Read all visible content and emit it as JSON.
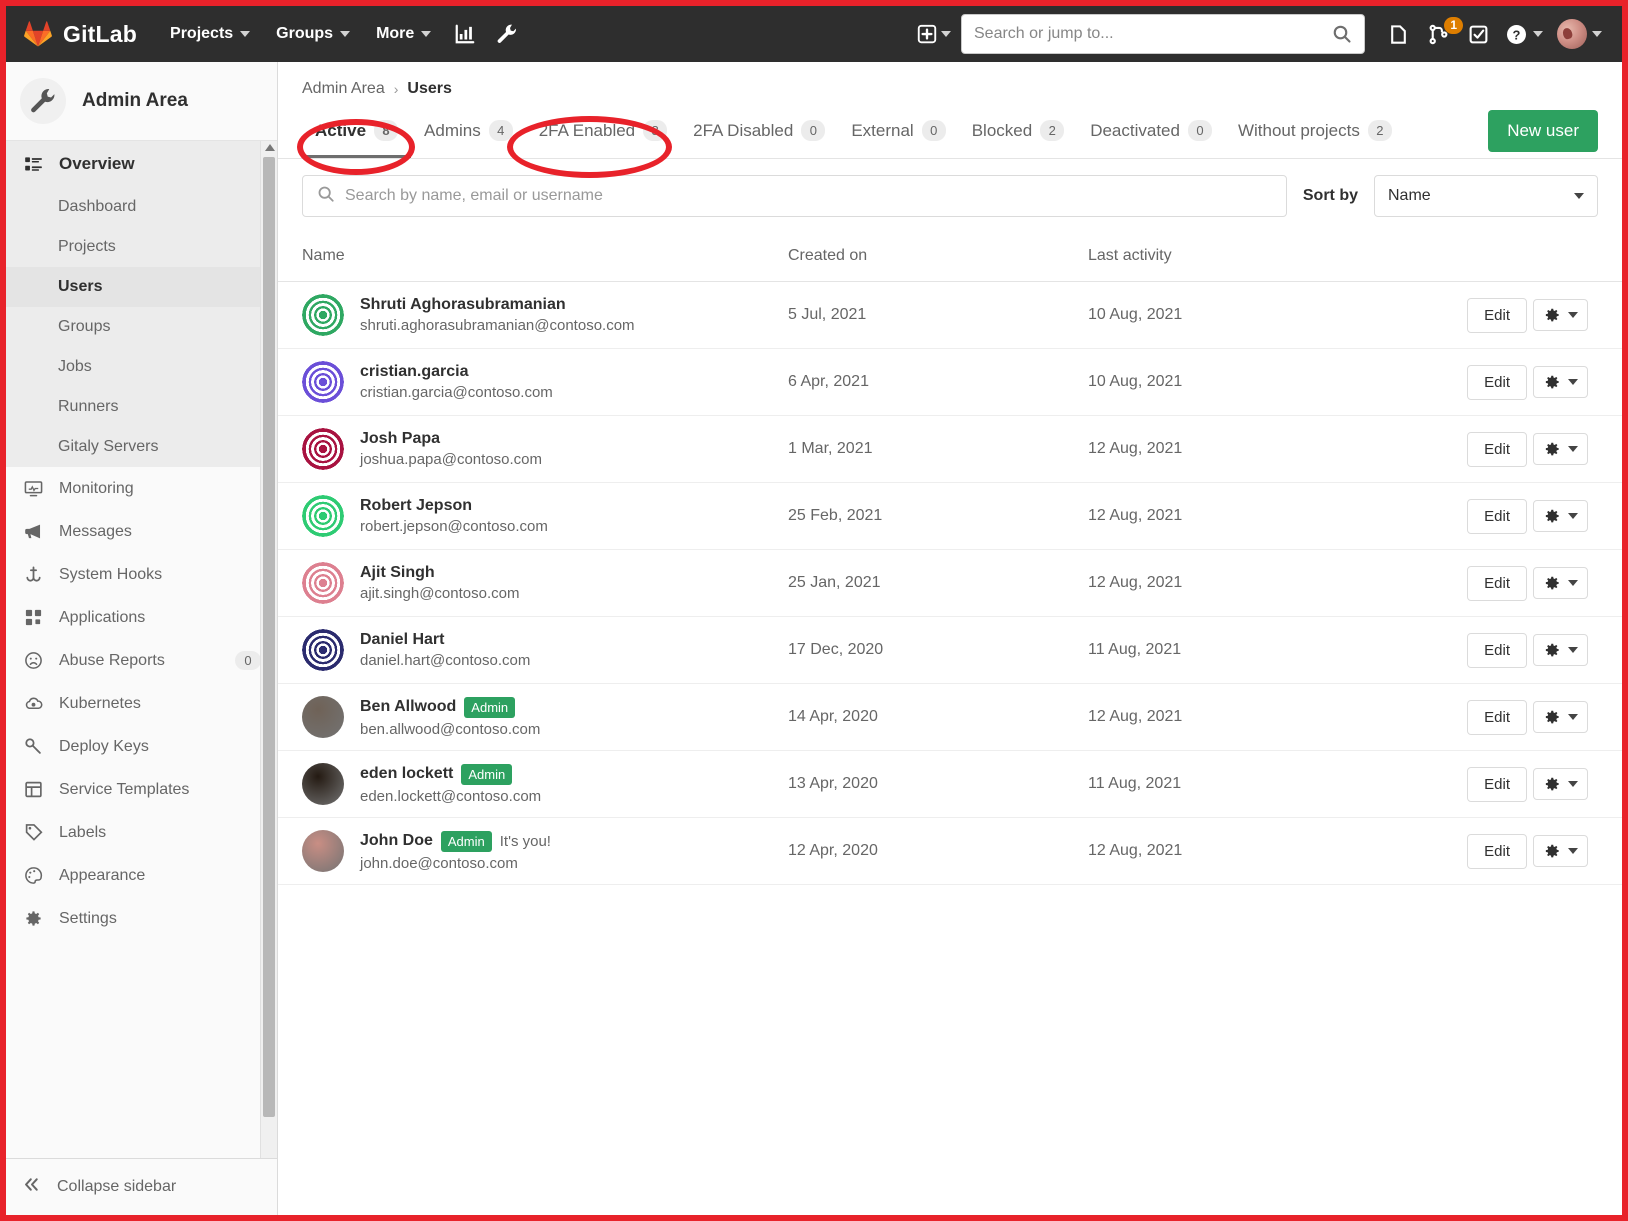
{
  "navbar": {
    "brand": "GitLab",
    "brand_icon": "gitlab-tanuki-logo",
    "links": [
      {
        "label": "Projects",
        "icon": "chevron-down-icon"
      },
      {
        "label": "Groups",
        "icon": "chevron-down-icon"
      },
      {
        "label": "More",
        "icon": "chevron-down-icon"
      }
    ],
    "icons": [
      "analytics-chart-icon",
      "wrench-admin-icon"
    ],
    "search_placeholder": "Search or jump to...",
    "search_value": "",
    "search_icon": "search-icon",
    "create_new_icon": "plus-square-icon",
    "issues_icon": "issues-icon",
    "merge_requests_icon": "merge-request-icon",
    "merge_requests_count": "1",
    "todos_icon": "todo-checkbox-icon",
    "help_icon": "question-circle-icon",
    "avatar_icon": "user-avatar"
  },
  "sidebar": {
    "title": "Admin Area",
    "title_icon": "wrench-icon",
    "overview": {
      "label": "Overview",
      "icon": "overview-list-icon"
    },
    "sub_items": [
      {
        "label": "Dashboard",
        "current": false
      },
      {
        "label": "Projects",
        "current": false
      },
      {
        "label": "Users",
        "current": true
      },
      {
        "label": "Groups",
        "current": false
      },
      {
        "label": "Jobs",
        "current": false
      },
      {
        "label": "Runners",
        "current": false
      },
      {
        "label": "Gitaly Servers",
        "current": false
      }
    ],
    "items": [
      {
        "label": "Monitoring",
        "icon": "monitor-icon",
        "count": null
      },
      {
        "label": "Messages",
        "icon": "megaphone-icon",
        "count": null
      },
      {
        "label": "System Hooks",
        "icon": "hook-icon",
        "count": null
      },
      {
        "label": "Applications",
        "icon": "applications-grid-icon",
        "count": null
      },
      {
        "label": "Abuse Reports",
        "icon": "frown-face-icon",
        "count": "0"
      },
      {
        "label": "Kubernetes",
        "icon": "kubernetes-cloud-icon",
        "count": null
      },
      {
        "label": "Deploy Keys",
        "icon": "key-icon",
        "count": null
      },
      {
        "label": "Service Templates",
        "icon": "template-layout-icon",
        "count": null
      },
      {
        "label": "Labels",
        "icon": "label-tag-icon",
        "count": null
      },
      {
        "label": "Appearance",
        "icon": "palette-icon",
        "count": null
      },
      {
        "label": "Settings",
        "icon": "settings-gear-icon",
        "count": null
      }
    ],
    "collapse": {
      "label": "Collapse sidebar",
      "icon": "double-chevron-left-icon"
    }
  },
  "breadcrumb": {
    "root": "Admin Area",
    "separator": "›",
    "current": "Users"
  },
  "tabs": [
    {
      "label": "Active",
      "count": "8",
      "active": true
    },
    {
      "label": "Admins",
      "count": "4",
      "active": false
    },
    {
      "label": "2FA Enabled",
      "count": "8",
      "active": false
    },
    {
      "label": "2FA Disabled",
      "count": "0",
      "active": false
    },
    {
      "label": "External",
      "count": "0",
      "active": false
    },
    {
      "label": "Blocked",
      "count": "2",
      "active": false
    },
    {
      "label": "Deactivated",
      "count": "0",
      "active": false
    },
    {
      "label": "Without projects",
      "count": "2",
      "active": false
    }
  ],
  "new_user_button": "New user",
  "filter": {
    "search_placeholder": "Search by name, email or username",
    "search_value": "",
    "search_icon": "search-icon",
    "sort_label": "Sort by",
    "sort_value": "Name",
    "sort_chevron": "chevron-down-icon"
  },
  "table": {
    "headers": [
      "Name",
      "Created on",
      "Last activity"
    ],
    "rows": [
      {
        "name": "Shruti Aghorasubramanian",
        "email": "shruti.aghorasubramanian@contoso.com",
        "admin": false,
        "its_you": false,
        "created_on": "5 Jul, 2021",
        "last_activity": "10 Aug, 2021",
        "avatar_color": "#2fa862",
        "avatar_type": "identicon"
      },
      {
        "name": "cristian.garcia",
        "email": "cristian.garcia@contoso.com",
        "admin": false,
        "its_you": false,
        "created_on": "6 Apr, 2021",
        "last_activity": "10 Aug, 2021",
        "avatar_color": "#6b4fd8",
        "avatar_type": "identicon"
      },
      {
        "name": "Josh Papa",
        "email": "joshua.papa@contoso.com",
        "admin": false,
        "its_you": false,
        "created_on": "1 Mar, 2021",
        "last_activity": "12 Aug, 2021",
        "avatar_color": "#a81240",
        "avatar_type": "identicon"
      },
      {
        "name": "Robert Jepson",
        "email": "robert.jepson@contoso.com",
        "admin": false,
        "its_you": false,
        "created_on": "25 Feb, 2021",
        "last_activity": "12 Aug, 2021",
        "avatar_color": "#2ecb73",
        "avatar_type": "identicon"
      },
      {
        "name": "Ajit Singh",
        "email": "ajit.singh@contoso.com",
        "admin": false,
        "its_you": false,
        "created_on": "25 Jan, 2021",
        "last_activity": "12 Aug, 2021",
        "avatar_color": "#dd8090",
        "avatar_type": "identicon"
      },
      {
        "name": "Daniel Hart",
        "email": "daniel.hart@contoso.com",
        "admin": false,
        "its_you": false,
        "created_on": "17 Dec, 2020",
        "last_activity": "11 Aug, 2021",
        "avatar_color": "#2b2b6e",
        "avatar_type": "identicon"
      },
      {
        "name": "Ben Allwood",
        "email": "ben.allwood@contoso.com",
        "admin": true,
        "its_you": false,
        "created_on": "14 Apr, 2020",
        "last_activity": "12 Aug, 2021",
        "avatar_color": "#6f6257",
        "avatar_type": "photo"
      },
      {
        "name": "eden lockett",
        "email": "eden.lockett@contoso.com",
        "admin": true,
        "its_you": false,
        "created_on": "13 Apr, 2020",
        "last_activity": "11 Aug, 2021",
        "avatar_color": "#241a12",
        "avatar_type": "photo"
      },
      {
        "name": "John Doe",
        "email": "john.doe@contoso.com",
        "admin": true,
        "its_you": true,
        "created_on": "12 Apr, 2020",
        "last_activity": "12 Aug, 2021",
        "avatar_color": "#c98e84",
        "avatar_type": "photo"
      }
    ],
    "admin_badge_label": "Admin",
    "its_you_label": "It's you!",
    "edit_label": "Edit",
    "gear_icon": "gear-icon",
    "gear_chevron": "chevron-down-icon"
  },
  "annotations": {
    "color": "#e8222a",
    "ellipses": [
      {
        "name": "active-tab-highlight"
      },
      {
        "name": "twofa-enabled-tab-highlight"
      }
    ]
  }
}
